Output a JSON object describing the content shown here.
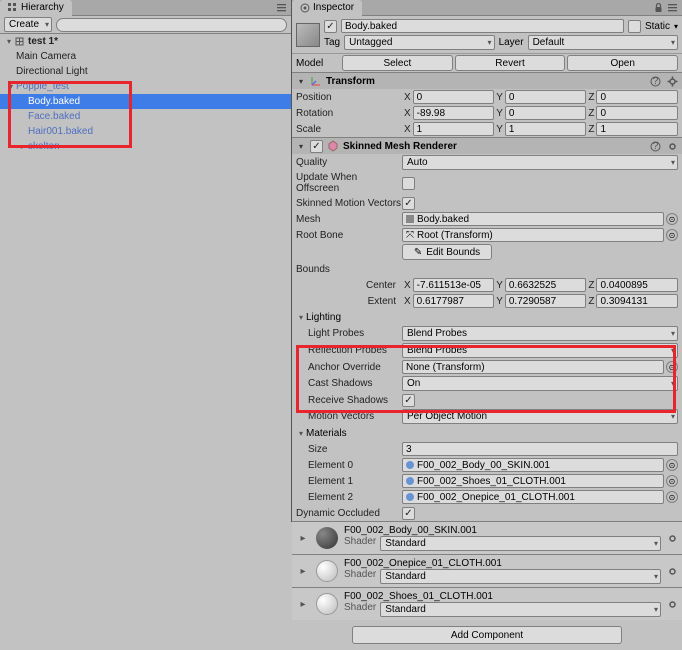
{
  "hierarchy": {
    "tab": "Hierarchy",
    "create": "Create",
    "root": "test 1*",
    "items": [
      "Main Camera",
      "Directional Light"
    ],
    "prefab": "Popple_test",
    "children": [
      "Body.baked",
      "Face.baked",
      "Hair001.baked",
      "skelton"
    ],
    "selected": "Body.baked"
  },
  "inspector": {
    "tab": "Inspector",
    "name": "Body.baked",
    "static": "Static",
    "tag_label": "Tag",
    "tag_value": "Untagged",
    "layer_label": "Layer",
    "layer_value": "Default",
    "model_label": "Model",
    "select": "Select",
    "revert": "Revert",
    "open": "Open",
    "transform": {
      "title": "Transform",
      "position": "Position",
      "rotation": "Rotation",
      "scale": "Scale",
      "pos": {
        "x": "0",
        "y": "0",
        "z": "0"
      },
      "rot": {
        "x": "-89.98",
        "y": "0",
        "z": "0"
      },
      "scl": {
        "x": "1",
        "y": "1",
        "z": "1"
      }
    },
    "smr": {
      "title": "Skinned Mesh Renderer",
      "quality": "Quality",
      "quality_val": "Auto",
      "update_offscreen": "Update When Offscreen",
      "skinned_motion": "Skinned Motion Vectors",
      "mesh": "Mesh",
      "mesh_val": "Body.baked",
      "root_bone": "Root Bone",
      "root_bone_val": "Root (Transform)",
      "bounds": "Bounds",
      "edit_bounds": "Edit Bounds",
      "center": "Center",
      "extent": "Extent",
      "center_v": {
        "x": "-7.611513e-05",
        "y": "0.6632525",
        "z": "0.0400895"
      },
      "extent_v": {
        "x": "0.6177987",
        "y": "0.7290587",
        "z": "0.3094131"
      },
      "lighting": "Lighting",
      "light_probes": "Light Probes",
      "light_probes_val": "Blend Probes",
      "reflection_probes": "Reflection Probes",
      "reflection_val": "Blend Probes",
      "anchor_override": "Anchor Override",
      "anchor_val": "None (Transform)",
      "cast_shadows": "Cast Shadows",
      "cast_val": "On",
      "receive_shadows": "Receive Shadows",
      "motion_vectors": "Motion Vectors",
      "motion_val": "Per Object Motion",
      "materials": "Materials",
      "size": "Size",
      "size_val": "3",
      "elements": [
        {
          "label": "Element 0",
          "val": "F00_002_Body_00_SKIN.001"
        },
        {
          "label": "Element 1",
          "val": "F00_002_Shoes_01_CLOTH.001"
        },
        {
          "label": "Element 2",
          "val": "F00_002_Onepice_01_CLOTH.001"
        }
      ],
      "dynamic_occluded": "Dynamic Occluded"
    },
    "mats": [
      {
        "name": "F00_002_Body_00_SKIN.001",
        "shader_label": "Shader",
        "shader": "Standard"
      },
      {
        "name": "F00_002_Onepice_01_CLOTH.001",
        "shader_label": "Shader",
        "shader": "Standard"
      },
      {
        "name": "F00_002_Shoes_01_CLOTH.001",
        "shader_label": "Shader",
        "shader": "Standard"
      }
    ],
    "add_component": "Add Component"
  }
}
